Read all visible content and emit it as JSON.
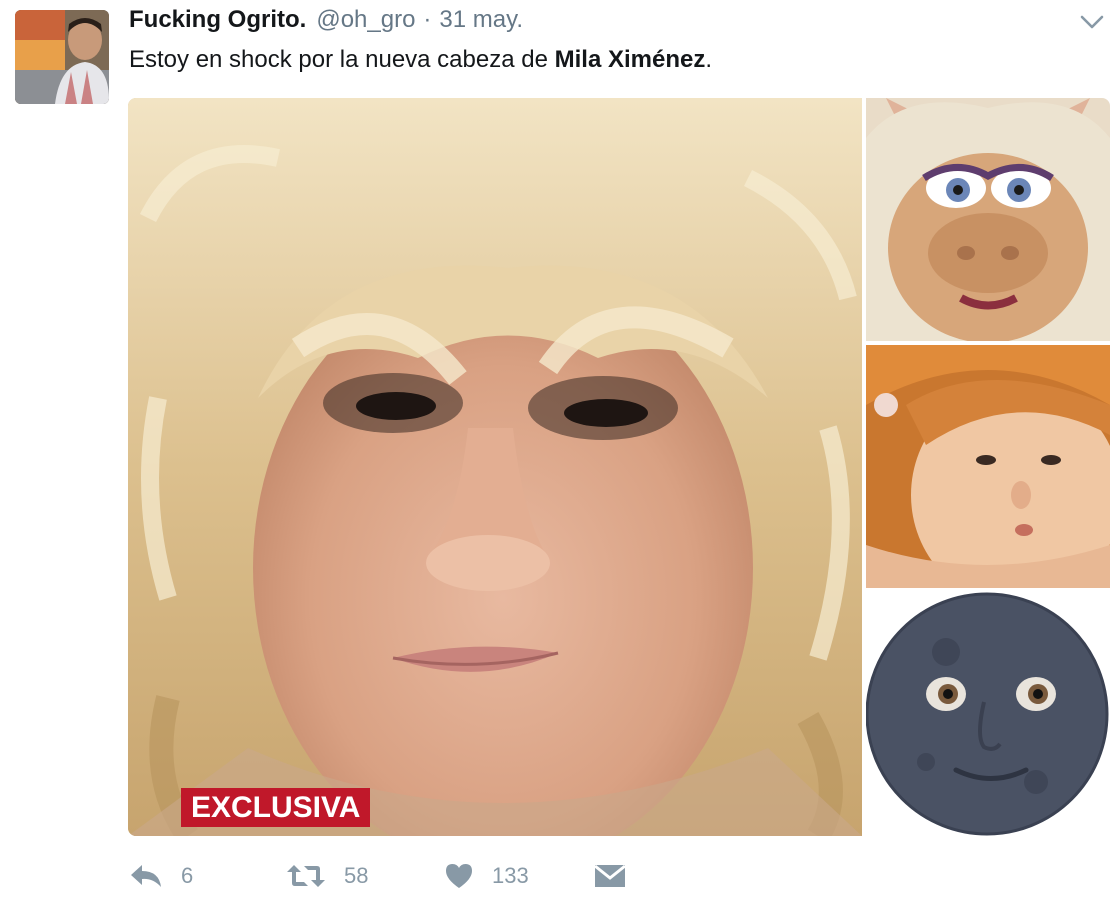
{
  "tweet": {
    "author_name": "Fucking Ogrito.",
    "author_handle": "@oh_gro",
    "separator": "·",
    "date": "31 may.",
    "text_before": "Estoy en shock por la nueva cabeza de ",
    "text_bold": "Mila Ximénez",
    "text_after": ".",
    "badge": "EXCLUSIVA"
  },
  "actions": {
    "reply": {
      "icon": "reply-icon",
      "count": "6"
    },
    "retweet": {
      "icon": "retweet-icon",
      "count": "58"
    },
    "like": {
      "icon": "heart-icon",
      "count": "133"
    },
    "message": {
      "icon": "envelope-icon"
    }
  },
  "colors": {
    "text": "#14171a",
    "secondary": "#657786",
    "action_icons": "#8899a6",
    "badge_bg": "#c0182a"
  }
}
